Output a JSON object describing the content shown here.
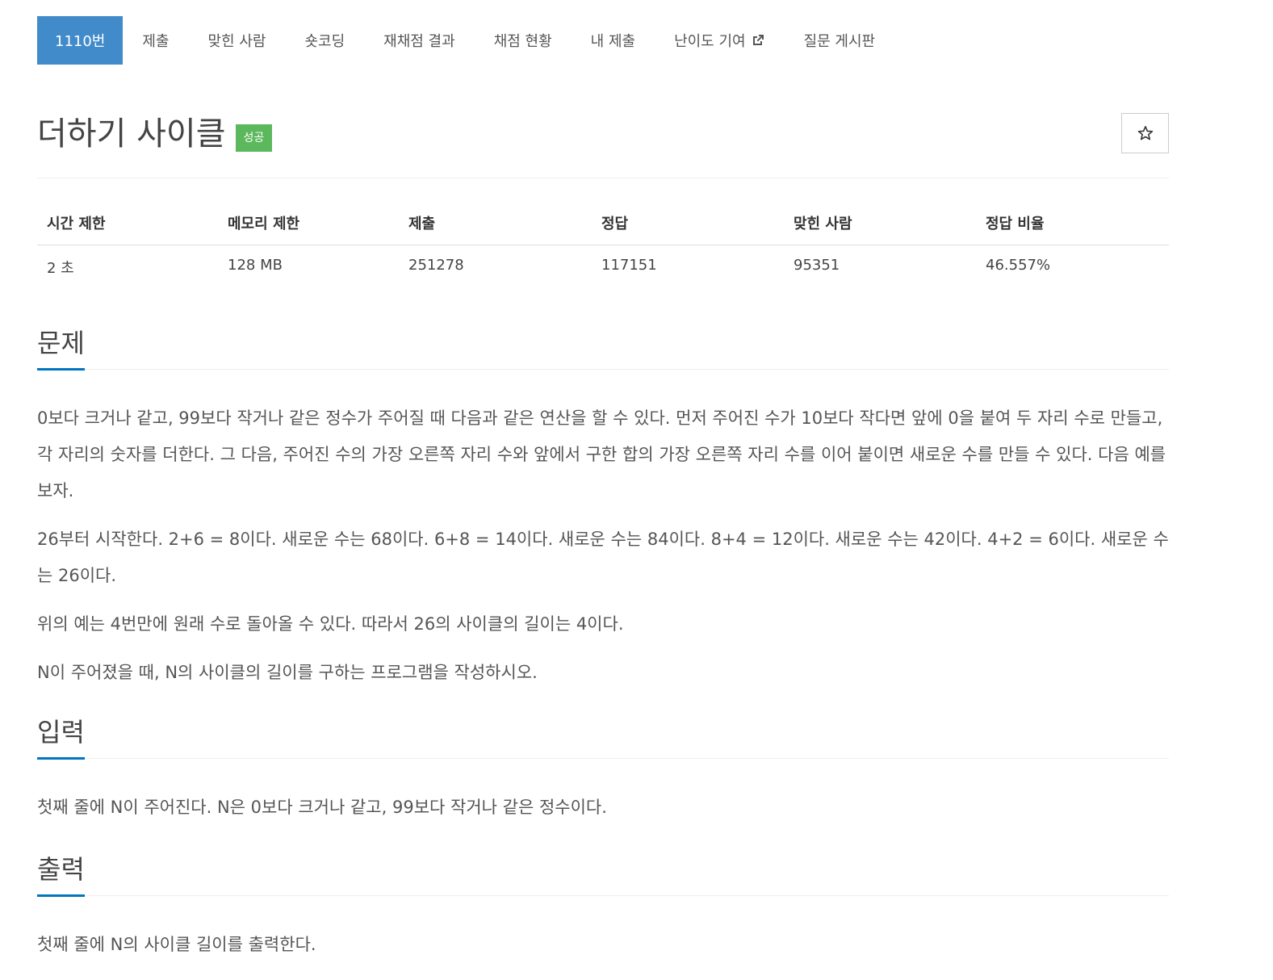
{
  "nav": {
    "items": [
      {
        "label": "1110번",
        "active": true
      },
      {
        "label": "제출"
      },
      {
        "label": "맞힌 사람"
      },
      {
        "label": "숏코딩"
      },
      {
        "label": "재채점 결과"
      },
      {
        "label": "채점 현황"
      },
      {
        "label": "내 제출"
      },
      {
        "label": "난이도 기여",
        "external": true
      },
      {
        "label": "질문 게시판"
      }
    ]
  },
  "problem": {
    "title": "더하기 사이클",
    "badge": "성공",
    "star_icon": "star-outline-icon",
    "accent_color": "#428bca",
    "badge_color": "#5cb85c"
  },
  "info": {
    "headers": [
      "시간 제한",
      "메모리 제한",
      "제출",
      "정답",
      "맞힌 사람",
      "정답 비율"
    ],
    "values": [
      "2 초",
      "128 MB",
      "251278",
      "117151",
      "95351",
      "46.557%"
    ]
  },
  "sections": {
    "description": {
      "title": "문제",
      "paragraphs": [
        "0보다 크거나 같고, 99보다 작거나 같은 정수가 주어질 때 다음과 같은 연산을 할 수 있다. 먼저 주어진 수가 10보다 작다면 앞에 0을 붙여 두 자리 수로 만들고, 각 자리의 숫자를 더한다. 그 다음, 주어진 수의 가장 오른쪽 자리 수와 앞에서 구한 합의 가장 오른쪽 자리 수를 이어 붙이면 새로운 수를 만들 수 있다. 다음 예를 보자.",
        "26부터 시작한다. 2+6 = 8이다. 새로운 수는 68이다. 6+8 = 14이다. 새로운 수는 84이다. 8+4 = 12이다. 새로운 수는 42이다. 4+2 = 6이다. 새로운 수는 26이다.",
        "위의 예는 4번만에 원래 수로 돌아올 수 있다. 따라서 26의 사이클의 길이는 4이다.",
        "N이 주어졌을 때, N의 사이클의 길이를 구하는 프로그램을 작성하시오."
      ]
    },
    "input": {
      "title": "입력",
      "paragraphs": [
        "첫째 줄에 N이 주어진다. N은 0보다 크거나 같고, 99보다 작거나 같은 정수이다."
      ]
    },
    "output": {
      "title": "출력",
      "paragraphs": [
        "첫째 줄에 N의 사이클 길이를 출력한다."
      ]
    }
  }
}
